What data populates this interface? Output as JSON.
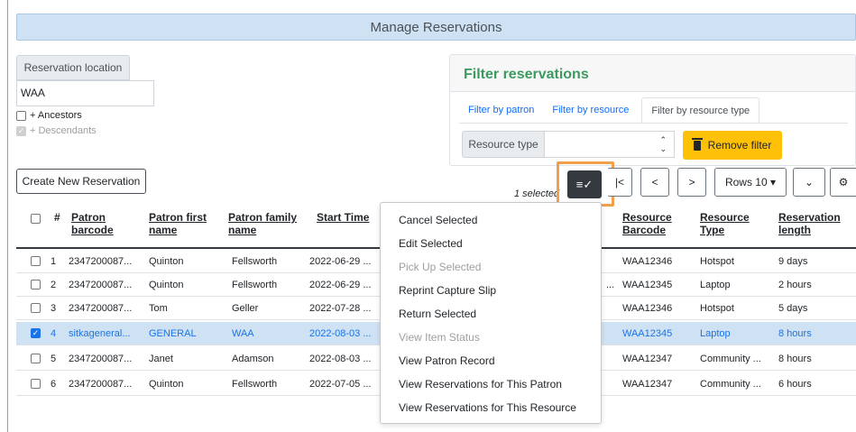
{
  "title": "Manage Reservations",
  "location": {
    "label": "Reservation location",
    "value": "WAA",
    "ancestors": "+ Ancestors",
    "descendants": "+ Descendants"
  },
  "create_button": "Create New Reservation",
  "filter": {
    "title": "Filter reservations",
    "tabs": [
      "Filter by patron",
      "Filter by resource",
      "Filter by resource type"
    ],
    "resource_type_label": "Resource type",
    "remove_button": "Remove filter"
  },
  "toolbar": {
    "selected_text": "1 selected",
    "first": "|<",
    "prev": "<",
    "next": ">",
    "rows": "Rows 10 ▾",
    "expand": "⌄",
    "settings": "⚙"
  },
  "columns": {
    "hash": "#",
    "patron_barcode": "Patron barcode",
    "first_name": "Patron first name",
    "family_name": "Patron family name",
    "start_time": "Start Time",
    "resource_barcode": "Resource Barcode",
    "resource_type": "Resource Type",
    "length": "Reservation length"
  },
  "rows": [
    {
      "num": "1",
      "barcode": "2347200087...",
      "first": "Quinton",
      "family": "Fellsworth",
      "start": "2022-06-29 ...",
      "extra": "",
      "res_barcode": "WAA12346",
      "res_type": "Hotspot",
      "length": "9 days"
    },
    {
      "num": "2",
      "barcode": "2347200087...",
      "first": "Quinton",
      "family": "Fellsworth",
      "start": "2022-06-29 ...",
      "extra": "...",
      "res_barcode": "WAA12345",
      "res_type": "Laptop",
      "length": "2 hours"
    },
    {
      "num": "3",
      "barcode": "2347200087...",
      "first": "Tom",
      "family": "Geller",
      "start": "2022-07-28 ...",
      "extra": "",
      "res_barcode": "WAA12346",
      "res_type": "Hotspot",
      "length": "5 days"
    },
    {
      "num": "4",
      "barcode": "sitkageneral...",
      "first": "GENERAL",
      "family": "WAA",
      "start": "2022-08-03 ...",
      "extra": "",
      "res_barcode": "WAA12345",
      "res_type": "Laptop",
      "length": "8 hours"
    },
    {
      "num": "5",
      "barcode": "2347200087...",
      "first": "Janet",
      "family": "Adamson",
      "start": "2022-08-03 ...",
      "extra": "",
      "res_barcode": "WAA12347",
      "res_type": "Community ...",
      "length": "8 hours"
    },
    {
      "num": "6",
      "barcode": "2347200087...",
      "first": "Quinton",
      "family": "Fellsworth",
      "start": "2022-07-05 ...",
      "extra": "",
      "res_barcode": "WAA12347",
      "res_type": "Community ...",
      "length": "6 hours"
    }
  ],
  "menu": [
    {
      "label": "Cancel Selected",
      "disabled": false
    },
    {
      "label": "Edit Selected",
      "disabled": false
    },
    {
      "label": "Pick Up Selected",
      "disabled": true
    },
    {
      "label": "Reprint Capture Slip",
      "disabled": false
    },
    {
      "label": "Return Selected",
      "disabled": false
    },
    {
      "label": "View Item Status",
      "disabled": true
    },
    {
      "label": "View Patron Record",
      "disabled": false
    },
    {
      "label": "View Reservations for This Patron",
      "disabled": false
    },
    {
      "label": "View Reservations for This Resource",
      "disabled": false
    }
  ]
}
